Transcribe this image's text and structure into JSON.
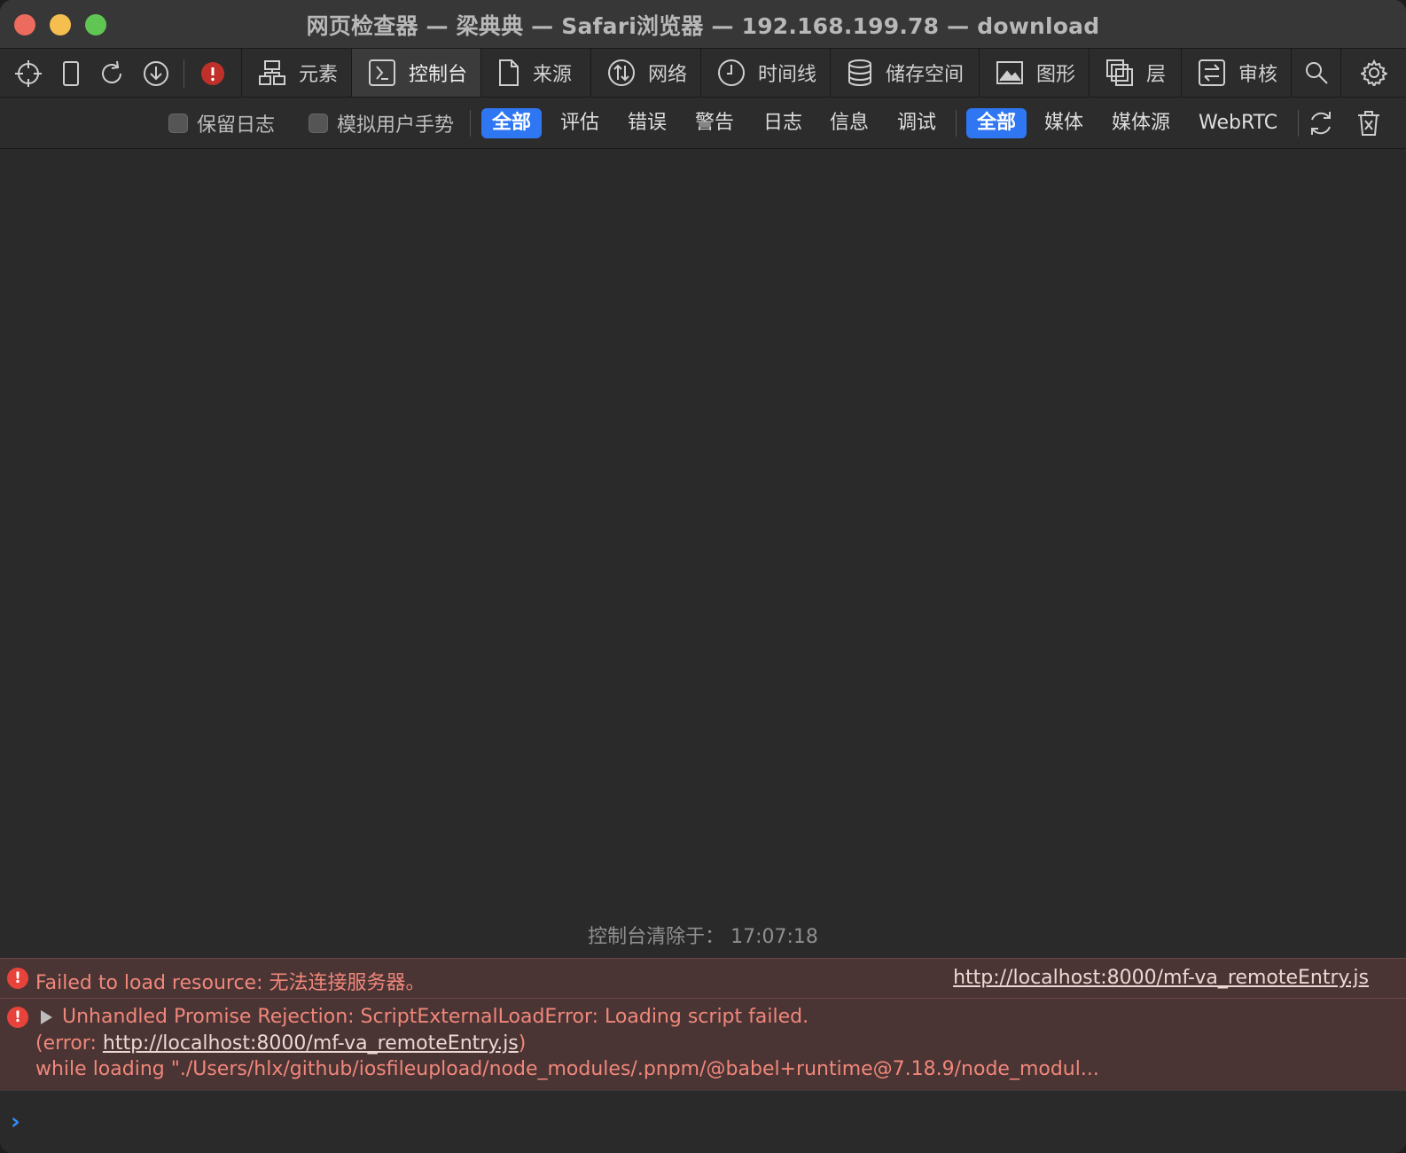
{
  "window": {
    "title": "网页检查器 — 梁典典 — Safari浏览器 — 192.168.199.78 — download"
  },
  "tabs": [
    {
      "label": "元素",
      "icon": "elements-icon"
    },
    {
      "label": "控制台",
      "icon": "console-icon",
      "active": true
    },
    {
      "label": "来源",
      "icon": "sources-icon"
    },
    {
      "label": "网络",
      "icon": "network-icon"
    },
    {
      "label": "时间线",
      "icon": "timeline-icon"
    },
    {
      "label": "储存空间",
      "icon": "storage-icon"
    },
    {
      "label": "图形",
      "icon": "graphics-icon"
    },
    {
      "label": "层",
      "icon": "layers-icon"
    },
    {
      "label": "审核",
      "icon": "audit-icon"
    }
  ],
  "filters": {
    "preserve_log": "保留日志",
    "emulate_gesture": "模拟用户手势",
    "levels": [
      "全部",
      "评估",
      "错误",
      "警告",
      "日志",
      "信息",
      "调试"
    ],
    "sources": [
      "全部",
      "媒体",
      "媒体源",
      "WebRTC"
    ]
  },
  "console": {
    "cleared_text": "控制台清除于：  17:07:18",
    "messages": [
      {
        "text": "Failed to load resource: 无法连接服务器。",
        "link": "http://localhost:8000/mf-va_remoteEntry.js"
      },
      {
        "line1": "Unhandled Promise Rejection: ScriptExternalLoadError: Loading script failed.",
        "line2_prefix": "(error: ",
        "line2_link": "http://localhost:8000/mf-va_remoteEntry.js",
        "line2_suffix": ")",
        "line3": "while loading \"./Users/hlx/github/iosfileupload/node_modules/.pnpm/@babel+runtime@7.18.9/node_modul..."
      }
    ],
    "prompt": "›"
  },
  "colors": {
    "selected_filter": "#2f77f2",
    "error_text": "#f0877a",
    "error_row_bg": "#4a3434"
  }
}
